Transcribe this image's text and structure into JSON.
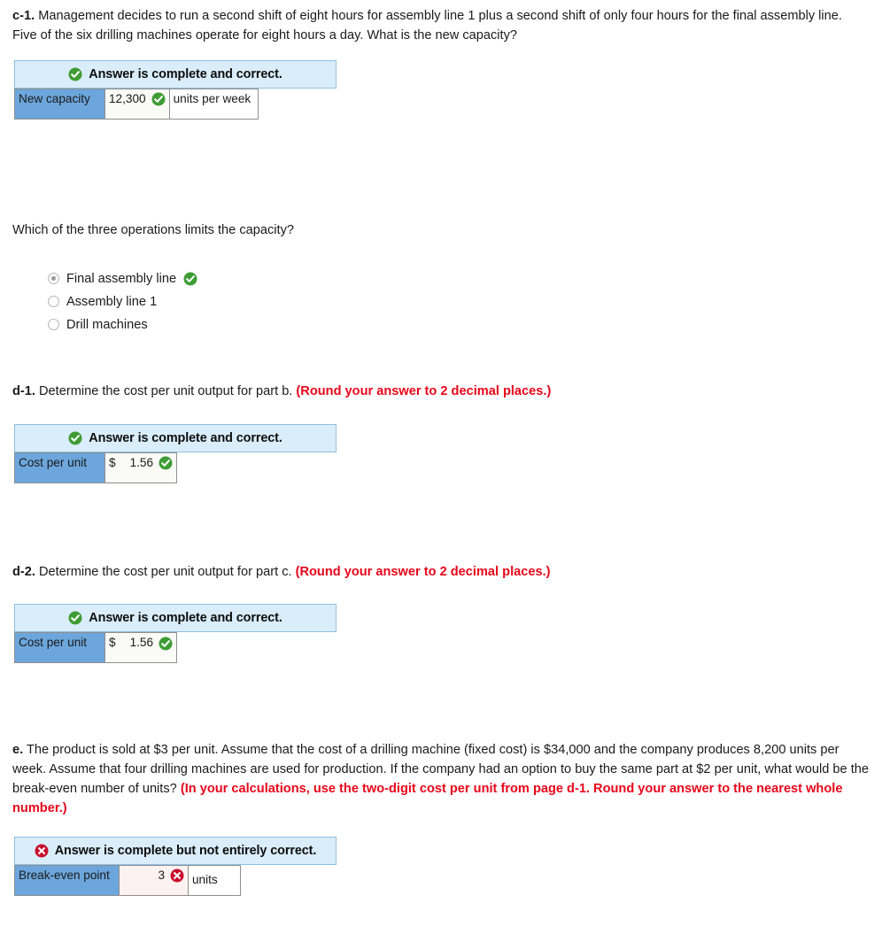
{
  "questions": {
    "c1": {
      "label": "c-1.",
      "text": " Management decides to run a second shift of eight hours for assembly line 1 plus a second shift of only four hours for the final assembly line. Five of the six drilling machines operate for eight hours a day. What is the new capacity?",
      "banner": "Answer is complete and correct.",
      "banner_status": "correct",
      "row": {
        "header": "New capacity",
        "value": "12,300",
        "mark": "correct",
        "unit": "units per week"
      }
    },
    "c1b": {
      "text": "Which of the three operations limits the capacity?",
      "options": [
        {
          "label": "Final assembly line",
          "selected": true,
          "mark": "correct"
        },
        {
          "label": "Assembly line 1",
          "selected": false,
          "mark": "none"
        },
        {
          "label": "Drill machines",
          "selected": false,
          "mark": "none"
        }
      ]
    },
    "d1": {
      "label": "d-1.",
      "text": " Determine the cost per unit output for part b. ",
      "note": "(Round your answer to 2 decimal places.)",
      "banner": "Answer is complete and correct.",
      "banner_status": "correct",
      "row": {
        "header": "Cost per unit",
        "prefix": "$",
        "value": "1.56",
        "mark": "correct"
      }
    },
    "d2": {
      "label": "d-2.",
      "text": " Determine the cost per unit output for part c. ",
      "note": "(Round your answer to 2 decimal places.)",
      "banner": "Answer is complete and correct.",
      "banner_status": "correct",
      "row": {
        "header": "Cost per unit",
        "prefix": "$",
        "value": "1.56",
        "mark": "correct"
      }
    },
    "e": {
      "label": "e.",
      "text": " The product is sold at $3 per unit. Assume that the cost of a drilling machine (fixed cost) is $34,000 and the company produces 8,200 units per week. Assume that four drilling machines are used for production. If the company had an option to buy the same part at $2 per unit, what would be the break-even number of units? ",
      "note": "(In your calculations, use the two-digit cost per unit from page d-1. Round your answer to the nearest whole number.)",
      "banner": "Answer is complete but not entirely correct.",
      "banner_status": "incorrect",
      "row": {
        "header": "Break-even point",
        "value": "3",
        "mark": "incorrect",
        "unit": "units"
      }
    }
  },
  "colors": {
    "banner_bg": "#daedfa",
    "banner_border": "#8fc0e0",
    "header_cell": "#6ca6dc",
    "correct_green": "#3f9c35",
    "incorrect_red": "#c8102e",
    "note_red": "#e8061a",
    "error_cell_bg": "#fdf2f2"
  },
  "icons": {
    "correct": "check-circle-icon",
    "incorrect": "x-circle-icon"
  }
}
